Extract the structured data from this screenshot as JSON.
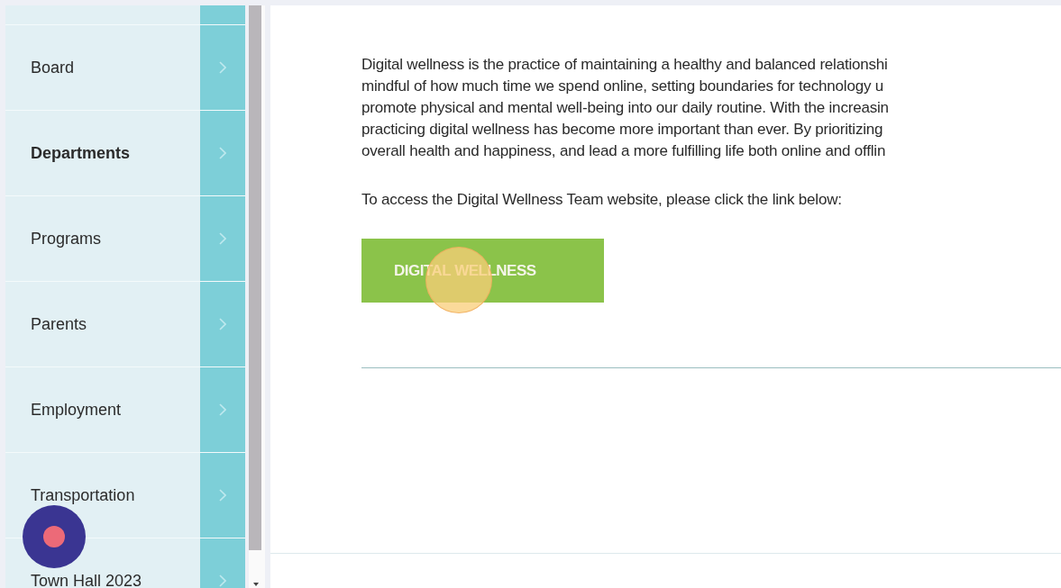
{
  "sidebar": {
    "items": [
      {
        "label": "Board",
        "selected": false
      },
      {
        "label": "Departments",
        "selected": true
      },
      {
        "label": "Programs",
        "selected": false
      },
      {
        "label": "Parents",
        "selected": false
      },
      {
        "label": "Employment",
        "selected": false
      },
      {
        "label": "Transportation",
        "selected": false
      },
      {
        "label": "Town Hall 2023",
        "selected": false
      }
    ]
  },
  "content": {
    "paragraph_lines": [
      "Digital wellness is the practice of maintaining a healthy and balanced relationshi",
      "mindful of how much time we spend online, setting boundaries for technology u",
      "promote physical and mental well-being into our daily routine. With the increasin",
      "practicing digital wellness has become more important than ever. By prioritizing",
      "overall health and happiness, and lead a more fulfilling life both online and offlin"
    ],
    "link_prompt": "To access the Digital Wellness Team website, please click the link below:",
    "button": {
      "label": "DIGITAL WELLNESS"
    }
  }
}
